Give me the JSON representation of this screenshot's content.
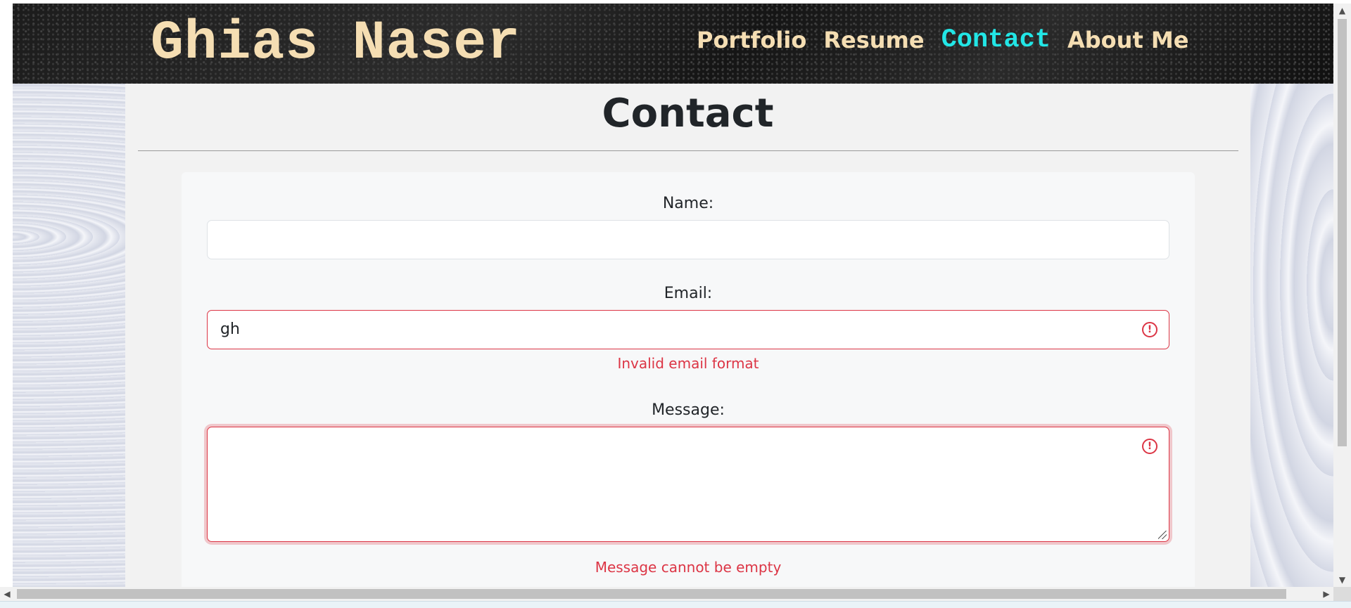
{
  "brand": {
    "name": "Ghias Naser"
  },
  "nav": {
    "items": [
      {
        "label": "Portfolio"
      },
      {
        "label": "Resume"
      },
      {
        "label": "Contact",
        "active": true
      },
      {
        "label": "About Me"
      }
    ]
  },
  "page": {
    "title": "Contact"
  },
  "form": {
    "name": {
      "label": "Name:",
      "value": ""
    },
    "email": {
      "label": "Email:",
      "value": "gh",
      "error": "Invalid email format"
    },
    "message": {
      "label": "Message:",
      "value": "",
      "error": "Message cannot be empty"
    }
  },
  "colors": {
    "brand": "#f5deb3",
    "nav_active": "#22e6e6",
    "error": "#dc3545",
    "panel": "#f2f2f2"
  },
  "icons": {
    "error": "exclamation-circle-icon"
  }
}
